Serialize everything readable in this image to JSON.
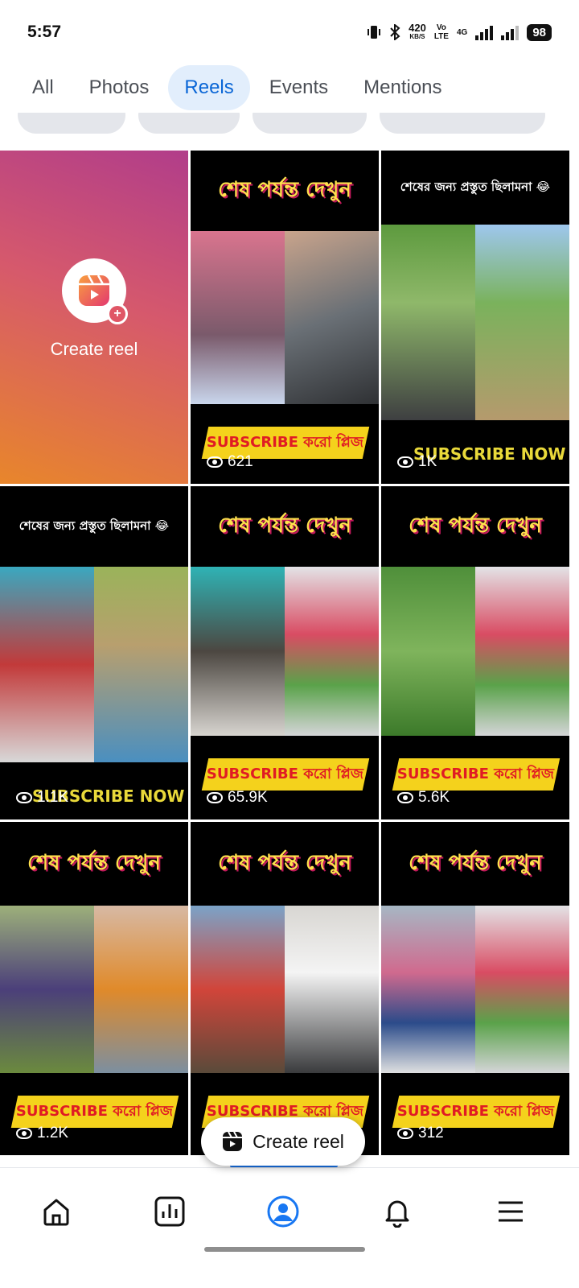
{
  "status_bar": {
    "time": "5:57",
    "net_speed": "420",
    "net_unit": "KB/S",
    "volte_top": "Vo",
    "volte_bottom": "LTE",
    "network": "4G",
    "battery": "98"
  },
  "tabs": [
    {
      "label": "All",
      "active": false
    },
    {
      "label": "Photos",
      "active": false
    },
    {
      "label": "Reels",
      "active": true
    },
    {
      "label": "Events",
      "active": false
    },
    {
      "label": "Mentions",
      "active": false
    }
  ],
  "create_tile": {
    "label": "Create reel"
  },
  "reels": [
    {
      "title": "শেষ পর্যন্ত দেখুন",
      "banner": "SUBSCRIBE করো প্লিজ",
      "views": "621"
    },
    {
      "title": "শেষের জন্য প্রস্তুত ছিলামনা 😂",
      "banner": "SUBSCRIBE NOW",
      "views": "1K"
    },
    {
      "title": "শেষের জন্য প্রস্তুত ছিলামনা 😂",
      "banner": "SUBSCRIBE NOW",
      "views": "1.1K"
    },
    {
      "title": "শেষ পর্যন্ত দেখুন",
      "banner": "SUBSCRIBE করো প্লিজ",
      "views": "65.9K"
    },
    {
      "title": "শেষ পর্যন্ত দেখুন",
      "banner": "SUBSCRIBE করো প্লিজ",
      "views": "5.6K"
    },
    {
      "title": "শেষ পর্যন্ত দেখুন",
      "banner": "SUBSCRIBE করো প্লিজ",
      "views": "1.2K"
    },
    {
      "title": "শেষ পর্যন্ত দেখুন",
      "banner": "SUBSCRIBE করো প্লিজ",
      "views": ""
    },
    {
      "title": "শেষ পর্যন্ত দেখুন",
      "banner": "SUBSCRIBE করো প্লিজ",
      "views": "312"
    }
  ],
  "fab": {
    "label": "Create reel"
  },
  "bottom_nav": {
    "items": [
      "home-icon",
      "dashboard-icon",
      "profile-icon",
      "bell-icon",
      "menu-icon"
    ],
    "active_color": "#1877f2"
  },
  "colors": {
    "accent": "#1877f2",
    "tab_active_bg": "#e2eefc"
  }
}
